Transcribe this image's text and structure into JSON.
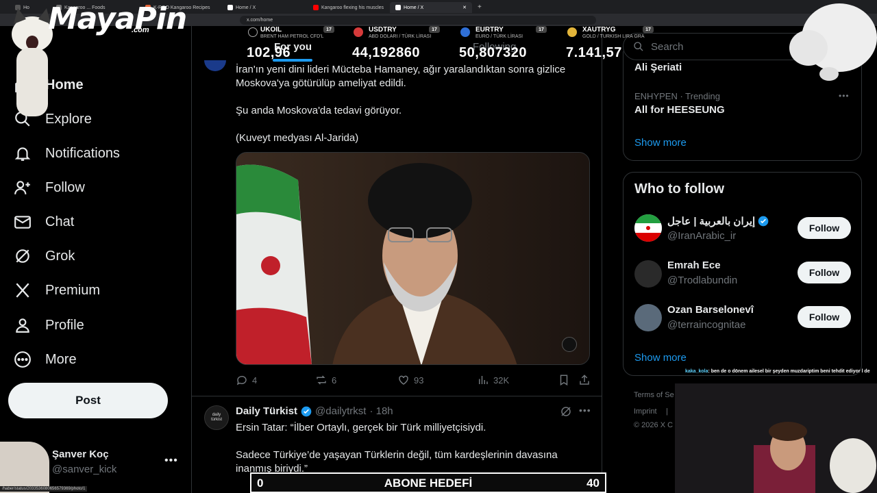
{
  "browser": {
    "tabs": [
      {
        "label": "Ho",
        "active": false
      },
      {
        "label": "Kangaroo ... Foods",
        "active": false
      },
      {
        "label": "K-ROO Kangaroo Recipes",
        "active": false
      },
      {
        "label": "Home / X",
        "active": false
      },
      {
        "label": "Kangaroo flexing his muscles",
        "active": false
      },
      {
        "label": "Home / X",
        "active": true
      }
    ],
    "url": "x.com/home"
  },
  "overlay": {
    "brand_main": "MayaPin",
    "brand_com": ".com",
    "tickers": [
      {
        "symbol": "UKOIL",
        "desc": "BRENT HAM PETROL CFD'L",
        "value": "102,96",
        "color": "#e7e9ea"
      },
      {
        "symbol": "USDTRY",
        "desc": "ABD DOLARI / TÜRK LİRASI",
        "value": "44,192860",
        "color": "#d63a3a"
      },
      {
        "symbol": "EURTRY",
        "desc": "EURO / TÜRK LİRASI",
        "value": "50,807320",
        "color": "#2f6fd6"
      },
      {
        "symbol": "XAUTRYG",
        "desc": "GOLD / TURKISH LIRA GRA",
        "value": "7.141,57",
        "color": "#e3b53a"
      }
    ],
    "tv_badge": "17",
    "goal": {
      "left": "0",
      "label": "ABONE HEDEFİ",
      "right": "40"
    },
    "chat": {
      "user": "kaka_kola",
      "message": ": ben de o dönem ailesel bir şeyden muzdariptim beni tehdit ediyor l de"
    },
    "status_url": "/haber/status/2033536080656579369/photo/1"
  },
  "sidebar": {
    "items": [
      {
        "label": "Home",
        "icon": "home-icon"
      },
      {
        "label": "Explore",
        "icon": "search-icon"
      },
      {
        "label": "Notifications",
        "icon": "bell-icon"
      },
      {
        "label": "Follow",
        "icon": "add-person-icon"
      },
      {
        "label": "Chat",
        "icon": "mail-icon"
      },
      {
        "label": "Grok",
        "icon": "grok-icon"
      },
      {
        "label": "Premium",
        "icon": "x-logo-icon"
      },
      {
        "label": "Profile",
        "icon": "person-icon"
      },
      {
        "label": "More",
        "icon": "more-circle-icon"
      }
    ],
    "post_label": "Post",
    "user": {
      "name": "Şanver Koç",
      "handle": "@sanver_kick",
      "more": "•••"
    }
  },
  "main": {
    "tabs": {
      "for_you": "For you",
      "following": "Following"
    },
    "post1": {
      "line1": "İran'ın yeni dini lideri Mücteba Hamaney, ağır yaralandıktan sonra gizlice",
      "line2": "Moskova'ya götürülüp ameliyat edildi.",
      "line3": "Şu anda Moskova'da tedavi görüyor.",
      "line4": "(Kuveyt medyası Al-Jarida)",
      "stats": {
        "replies": "4",
        "reposts": "6",
        "likes": "93",
        "views": "32K"
      }
    },
    "post2": {
      "author": "Daily Türkist",
      "handle": "@dailytrkst",
      "time": "· 18h",
      "avatar_text": "daily türkist",
      "line1": "Ersin Tatar: “İlber Ortaylı, gerçek bir Türk milliyetçisiydi.",
      "line2": "Sadece Türkiye’de yaşayan Türklerin değil, tüm kardeşlerinin davasına",
      "line3": "inanmış biriydi.”"
    }
  },
  "right": {
    "search_placeholder": "Search",
    "trend_top": "Ali Şeriati",
    "trend2": {
      "context": "ENHYPEN · Trending",
      "title": "All for HEESEUNG"
    },
    "show_more": "Show more",
    "who_to_follow": {
      "title": "Who to follow",
      "accounts": [
        {
          "name": "إيران بالعربية | عاجل",
          "handle": "@IranArabic_ir",
          "button": "Follow"
        },
        {
          "name": "Emrah Ece",
          "handle": "@Trodlabundin",
          "button": "Follow"
        },
        {
          "name": "Ozan Barselonevî",
          "handle": "@terraincognitae",
          "button": "Follow"
        }
      ],
      "show_more": "Show more"
    },
    "footer": {
      "terms": "Terms of Se",
      "imprint": "Imprint",
      "sep": "|",
      "copyright": "© 2026 X C"
    }
  },
  "colors": {
    "accent": "#1d9bf0",
    "background": "#000000",
    "border": "#2f3336",
    "muted": "#71767b"
  }
}
